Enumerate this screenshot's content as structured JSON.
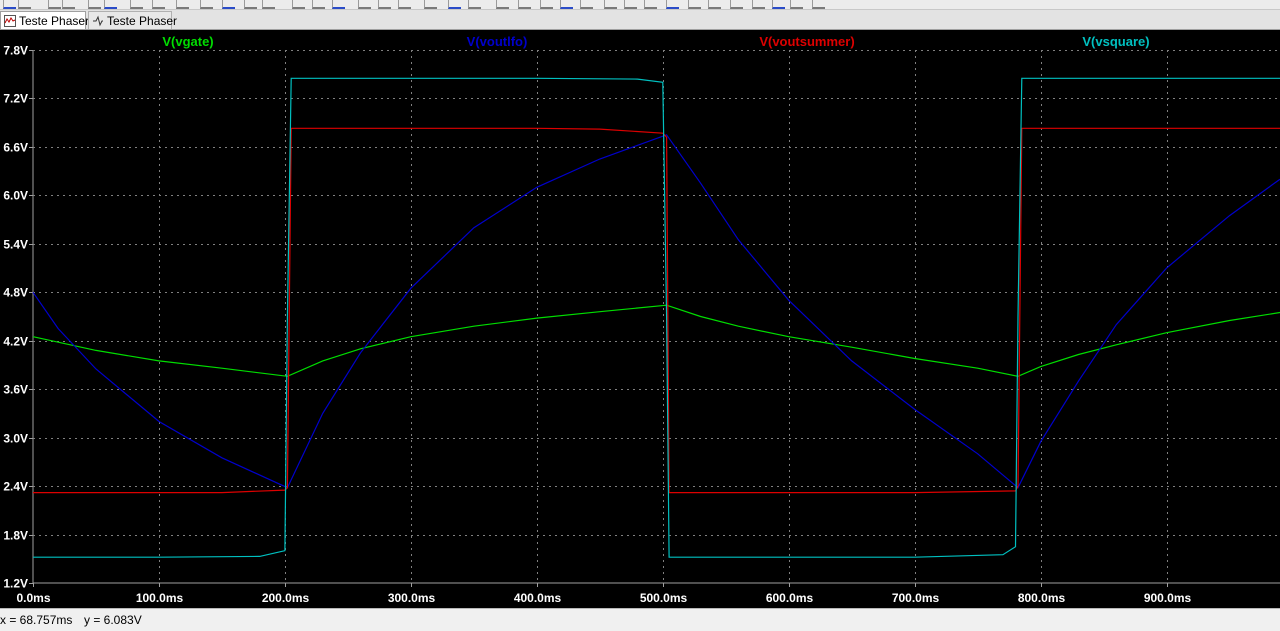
{
  "tabs": [
    {
      "label": "Teste Phaser",
      "icon": "waveform-icon",
      "active": true
    },
    {
      "label": "Teste Phaser",
      "icon": "schematic-icon",
      "active": false
    }
  ],
  "status": {
    "cursor_x": "x = 68.757ms",
    "cursor_y": "y = 6.083V"
  },
  "colors": {
    "background": "#000000",
    "grid": "#808080",
    "axis_text": "#ffffff"
  },
  "chart_data": {
    "type": "line",
    "title": "",
    "xlabel": "",
    "ylabel": "",
    "xlim": [
      0,
      990
    ],
    "ylim": [
      1.2,
      7.8
    ],
    "grid": true,
    "legend": "top",
    "x_ticks": [
      0,
      100,
      200,
      300,
      400,
      500,
      600,
      700,
      800,
      900
    ],
    "x_tick_labels": [
      "0.0ms",
      "100.0ms",
      "200.0ms",
      "300.0ms",
      "400.0ms",
      "500.0ms",
      "600.0ms",
      "700.0ms",
      "800.0ms",
      "900.0ms"
    ],
    "y_ticks": [
      1.2,
      1.8,
      2.4,
      3.0,
      3.6,
      4.2,
      4.8,
      5.4,
      6.0,
      6.6,
      7.2,
      7.8
    ],
    "y_tick_labels": [
      "1.2V",
      "1.8V",
      "2.4V",
      "3.0V",
      "3.6V",
      "4.2V",
      "4.8V",
      "5.4V",
      "6.0V",
      "6.6V",
      "7.2V",
      "7.8V"
    ],
    "series": [
      {
        "name": "V(vgate)",
        "color": "#00dd00",
        "x": [
          0,
          50,
          100,
          150,
          202,
          230,
          260,
          300,
          350,
          400,
          450,
          503,
          530,
          560,
          600,
          650,
          700,
          750,
          782,
          800,
          830,
          860,
          900,
          950,
          990
        ],
        "y": [
          4.25,
          4.08,
          3.95,
          3.86,
          3.76,
          3.95,
          4.1,
          4.25,
          4.38,
          4.48,
          4.56,
          4.64,
          4.5,
          4.38,
          4.25,
          4.12,
          3.98,
          3.86,
          3.76,
          3.88,
          4.03,
          4.15,
          4.3,
          4.45,
          4.55
        ]
      },
      {
        "name": "V(voutlfo)",
        "color": "#0000cc",
        "x": [
          0,
          20,
          50,
          100,
          150,
          202,
          230,
          260,
          300,
          350,
          400,
          450,
          503,
          530,
          560,
          600,
          650,
          700,
          750,
          782,
          800,
          830,
          860,
          900,
          950,
          990
        ],
        "y": [
          4.8,
          4.35,
          3.85,
          3.2,
          2.75,
          2.38,
          3.3,
          4.05,
          4.85,
          5.6,
          6.1,
          6.45,
          6.75,
          6.15,
          5.45,
          4.7,
          3.95,
          3.35,
          2.8,
          2.38,
          2.95,
          3.7,
          4.4,
          5.1,
          5.75,
          6.2
        ]
      },
      {
        "name": "V(voutsummer)",
        "color": "#dd0000",
        "x": [
          0,
          150,
          200,
          202,
          205,
          300,
          400,
          450,
          500,
          503,
          505,
          600,
          700,
          780,
          782,
          785,
          900,
          990
        ],
        "y": [
          2.32,
          2.32,
          2.35,
          2.38,
          6.83,
          6.83,
          6.83,
          6.82,
          6.77,
          6.72,
          2.32,
          2.32,
          2.32,
          2.34,
          2.4,
          6.83,
          6.83,
          6.83
        ]
      },
      {
        "name": "V(vsquare)",
        "color": "#00c0c0",
        "x": [
          0,
          100,
          180,
          200,
          202,
          205,
          300,
          400,
          480,
          500,
          503,
          505,
          600,
          700,
          770,
          780,
          782,
          785,
          900,
          990
        ],
        "y": [
          1.52,
          1.52,
          1.53,
          1.6,
          4.5,
          7.45,
          7.45,
          7.45,
          7.44,
          7.4,
          4.5,
          1.52,
          1.52,
          1.52,
          1.55,
          1.65,
          4.5,
          7.45,
          7.45,
          7.45
        ]
      }
    ]
  }
}
